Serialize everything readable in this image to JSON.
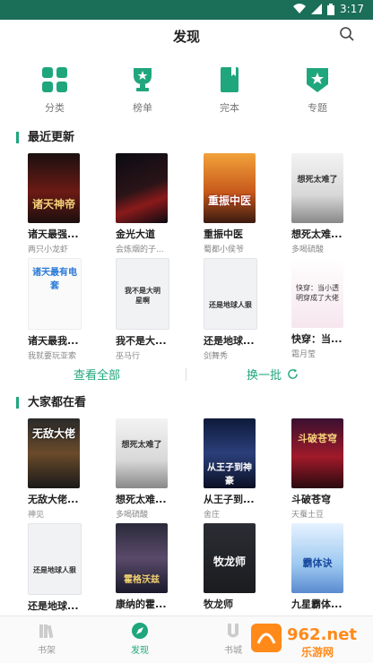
{
  "status": {
    "time": "3:17"
  },
  "header": {
    "title": "发现"
  },
  "categories": [
    {
      "label": "分类",
      "icon": "grid-icon"
    },
    {
      "label": "榜单",
      "icon": "trophy-icon"
    },
    {
      "label": "完本",
      "icon": "book-icon"
    },
    {
      "label": "专题",
      "icon": "star-badge-icon"
    }
  ],
  "recent": {
    "title": "最近更新",
    "books": [
      {
        "title": "诸天最强...",
        "author": "两只小龙虾",
        "cover_text": "诸天神帝"
      },
      {
        "title": "金光大道",
        "author": "会炼烟的子...",
        "cover_text": ""
      },
      {
        "title": "重振中医",
        "author": "蜀都小侯爷",
        "cover_text": "重振中医"
      },
      {
        "title": "想死太难...",
        "author": "多喝硫酸",
        "cover_text": "想死太难了"
      },
      {
        "title": "诸天最我...",
        "author": "我就要玩亚索",
        "cover_text": "诸天最有电套"
      },
      {
        "title": "我不是大...",
        "author": "巫马行",
        "cover_text": "我不是大明星啊"
      },
      {
        "title": "还是地球...",
        "author": "剑舞秀",
        "cover_text": "还是地球人狠"
      },
      {
        "title": "快穿：当...",
        "author": "霜月莹",
        "cover_text": "快穿：当小透明穿成了大佬"
      }
    ]
  },
  "actions": {
    "view_all": "查看全部",
    "refresh": "换一批"
  },
  "popular": {
    "title": "大家都在看",
    "books": [
      {
        "title": "无敌大佬...",
        "author": "神见",
        "cover_text": "无敌大佬"
      },
      {
        "title": "想死太难...",
        "author": "多喝硫酸",
        "cover_text": "想死太难了"
      },
      {
        "title": "从王子到...",
        "author": "舍庄",
        "cover_text": "从王子到神豪"
      },
      {
        "title": "斗破苍穹",
        "author": "天蚕土豆",
        "cover_text": "斗破苍穹"
      },
      {
        "title": "还是地球...",
        "author": "",
        "cover_text": "还是地球人狠"
      },
      {
        "title": "康纳的霍...",
        "author": "",
        "cover_text": "霍格沃兹"
      },
      {
        "title": "牧龙师",
        "author": "",
        "cover_text": "牧龙师"
      },
      {
        "title": "九星霸体...",
        "author": "",
        "cover_text": "霸体诀"
      }
    ]
  },
  "tabs": [
    {
      "label": "书架",
      "icon": "bookshelf-icon"
    },
    {
      "label": "发现",
      "icon": "compass-icon"
    },
    {
      "label": "书城",
      "icon": "store-icon"
    }
  ],
  "watermark": {
    "brand": "962.net",
    "sub": "乐游网"
  },
  "colors": {
    "accent": "#1fa67c",
    "statusbar": "#1b6e58"
  }
}
